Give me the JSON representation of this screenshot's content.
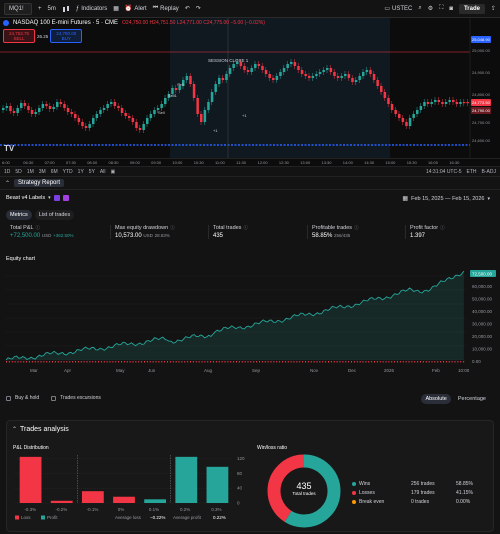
{
  "toolbar": {
    "symbol": "MQ1!",
    "interval": "5m",
    "indicators": "Indicators",
    "alert": "Alert",
    "replay": "Replay",
    "layout": "USTEC",
    "trade": "Trade"
  },
  "chart": {
    "title": "NASDAQ 100 E-mini Futures · 5 · CME",
    "ohlc": "O24,750.00 H24,751.50 L24,771.00 C24,775.00 −5.00 (−0.02%)",
    "sell_price": "24,753.75",
    "sell_label": "SELL",
    "spread": "26.25",
    "buy_price": "24,780.00",
    "buy_label": "BUY",
    "session_label": "SESSION CLOSE 1",
    "price_badges": [
      "25,048.90",
      "24,773.50",
      "24,790.00"
    ],
    "y_ticks": [
      "25,000.00",
      "24,900.00",
      "24,800.00",
      "24,700.00",
      "24,600.00"
    ],
    "time_ticks": [
      "6:00",
      "06:30",
      "07:00",
      "07:30",
      "08:00",
      "08:30",
      "09:00",
      "09:30",
      "10:00",
      "10:30",
      "11:00",
      "11:30",
      "12:00",
      "12:30",
      "13:00",
      "13:30",
      "14:00",
      "14:30",
      "15:00",
      "15:30",
      "16:00",
      "16:30"
    ],
    "marks": [
      "Sell1",
      "Sell",
      "Sell",
      "+1",
      "+1"
    ],
    "logo": "TV"
  },
  "range_bar": {
    "ranges": [
      "1D",
      "5D",
      "1M",
      "3M",
      "6M",
      "YTD",
      "1Y",
      "5Y",
      "All"
    ],
    "clock": "14:31:04 UTC-5",
    "session": "ETH",
    "adj": "B-ADJ"
  },
  "report": {
    "tab_title": "Strategy Report",
    "strategy_name": "Beast v4 Labels",
    "date_range": "Feb 15, 2025 — Feb 15, 2026",
    "tabs": [
      "Metrics",
      "List of trades"
    ],
    "metrics": [
      {
        "label": "Total P&L",
        "value": "+72,500.00",
        "unit": "USD",
        "sub": "+362.50%",
        "color": "#26a69a"
      },
      {
        "label": "Max equity drawdown",
        "value": "10,573.00",
        "unit": "USD",
        "sub": "28.83%",
        "color": "#ffffff"
      },
      {
        "label": "Total trades",
        "value": "435",
        "unit": "",
        "sub": "",
        "color": "#ffffff"
      },
      {
        "label": "Profitable trades",
        "value": "58.85%",
        "unit": "",
        "sub": "256/435",
        "color": "#ffffff"
      },
      {
        "label": "Profit factor",
        "value": "1.397",
        "unit": "",
        "sub": "",
        "color": "#ffffff"
      }
    ],
    "equity_title": "Equity chart",
    "equity_last": "72,500.00",
    "equity_y_ticks": [
      "60,000.00",
      "50,000.00",
      "40,000.00",
      "30,000.00",
      "20,000.00",
      "10,000.00",
      "0.00"
    ],
    "equity_x_ticks": [
      "Mar",
      "Apr",
      "May",
      "Jun",
      "Aug",
      "Sep",
      "Nov",
      "Dec",
      "2026",
      "Feb",
      "10:00"
    ],
    "toggles": [
      "Buy & hold",
      "Trades excursions"
    ],
    "scale_modes": [
      "Absolute",
      "Percentage"
    ],
    "analysis_title": "Trades analysis",
    "pnl_title": "P&L Distribution",
    "winloss_title": "Win/loss ratio",
    "legend_loss": "Loss",
    "legend_profit": "Profit",
    "avg_loss": "Average loss",
    "avg_loss_val": "−0.22%",
    "avg_profit": "Average profit",
    "avg_profit_val": "0.22%",
    "donut_total": "435",
    "donut_label": "Total trades",
    "winloss_rows": [
      {
        "label": "Wins",
        "trades": "256 trades",
        "pct": "58.85%",
        "color": "#26a69a"
      },
      {
        "label": "Losses",
        "trades": "179 trades",
        "pct": "41.15%",
        "color": "#f23645"
      },
      {
        "label": "Break even",
        "trades": "0 trades",
        "pct": "0.00%",
        "color": "#ff9800"
      }
    ]
  },
  "chart_data": {
    "type": "bar",
    "title": "P&L Distribution",
    "categories": [
      "-0.3%",
      "-0.2%",
      "-0.1%",
      "0%",
      "0.1%",
      "0.2%",
      "0.3%"
    ],
    "series": [
      {
        "name": "Loss",
        "color": "#f23645",
        "values": [
          125,
          6,
          32,
          17,
          0,
          0,
          0
        ]
      },
      {
        "name": "Profit",
        "color": "#26a69a",
        "values": [
          0,
          0,
          0,
          0,
          10,
          125,
          98
        ]
      }
    ],
    "y_ticks": [
      "120",
      "80",
      "40",
      "0"
    ],
    "ylim": [
      0,
      130
    ]
  }
}
